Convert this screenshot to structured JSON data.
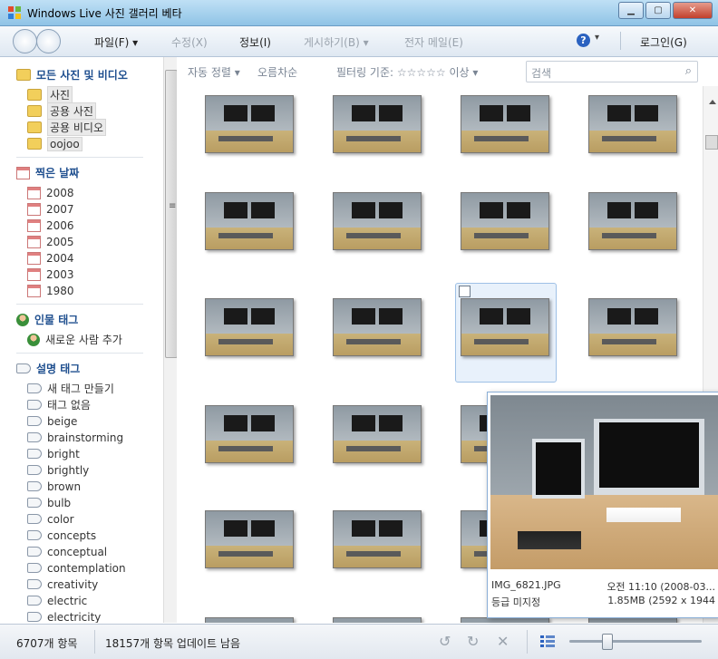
{
  "window": {
    "title": "Windows Live 사진 갤러리 베타"
  },
  "menu": {
    "file": "파일(F) ▾",
    "edit": "수정(X)",
    "info": "정보(I)",
    "publish": "게시하기(B) ▾",
    "email": "전자 메일(E)",
    "help": "?",
    "login": "로그인(G)"
  },
  "sidebar": {
    "all": "모든 사진 및 비디오",
    "folders": [
      "사진",
      "공용 사진",
      "공용 비디오",
      "oojoo"
    ],
    "date_head": "찍은 날짜",
    "years": [
      "2008",
      "2007",
      "2006",
      "2005",
      "2004",
      "2003",
      "1980"
    ],
    "people_head": "인물 태그",
    "add_person": "새로운 사람 추가",
    "tags_head": "설명 태그",
    "tags": [
      "새 태그 만들기",
      "태그 없음",
      "beige",
      "brainstorming",
      "bright",
      "brightly",
      "brown",
      "bulb",
      "color",
      "concepts",
      "conceptual",
      "contemplation",
      "creativity",
      "electric",
      "electricity"
    ]
  },
  "toolbar": {
    "sort": "자동 정렬 ▾",
    "order": "오름차순",
    "filter": "필터링 기준: ☆☆☆☆☆ 이상 ▾",
    "search_placeholder": "검색"
  },
  "preview": {
    "filename": "IMG_6821.JPG",
    "time": "오전 11:10 (2008-03...",
    "rating": "등급 미지정",
    "size": "1.85MB (2592 x 1944"
  },
  "status": {
    "count": "6707개 항목",
    "updating": "18157개 항목 업데이트 남음"
  },
  "colors": {
    "accent": "#1f4f8f",
    "selection": "#e8f1fb"
  }
}
